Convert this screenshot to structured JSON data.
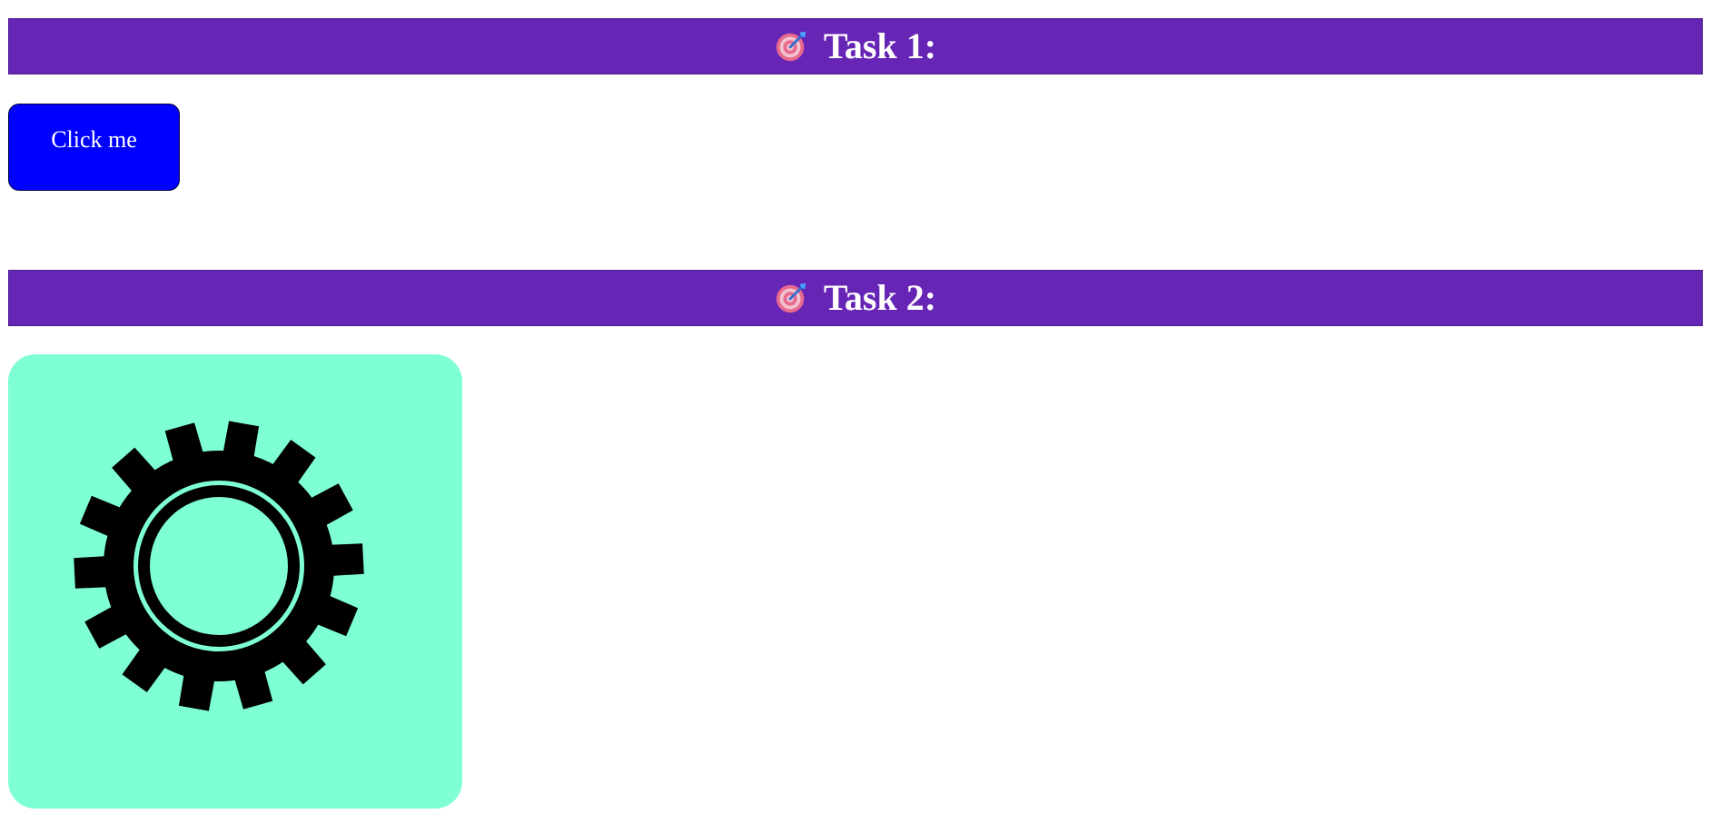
{
  "colors": {
    "header_bg": "#6725b5",
    "header_text": "#ffffff",
    "button_bg": "#0000ff",
    "button_text": "#ffffff",
    "tile_bg": "#7fffd4",
    "gear": "#000000"
  },
  "tasks": [
    {
      "title": "Task 1:",
      "icon": "target-dart-icon"
    },
    {
      "title": "Task 2:",
      "icon": "target-dart-icon"
    }
  ],
  "task1": {
    "button_label": "Click me"
  },
  "task2": {
    "tile_icon": "gear-icon"
  }
}
